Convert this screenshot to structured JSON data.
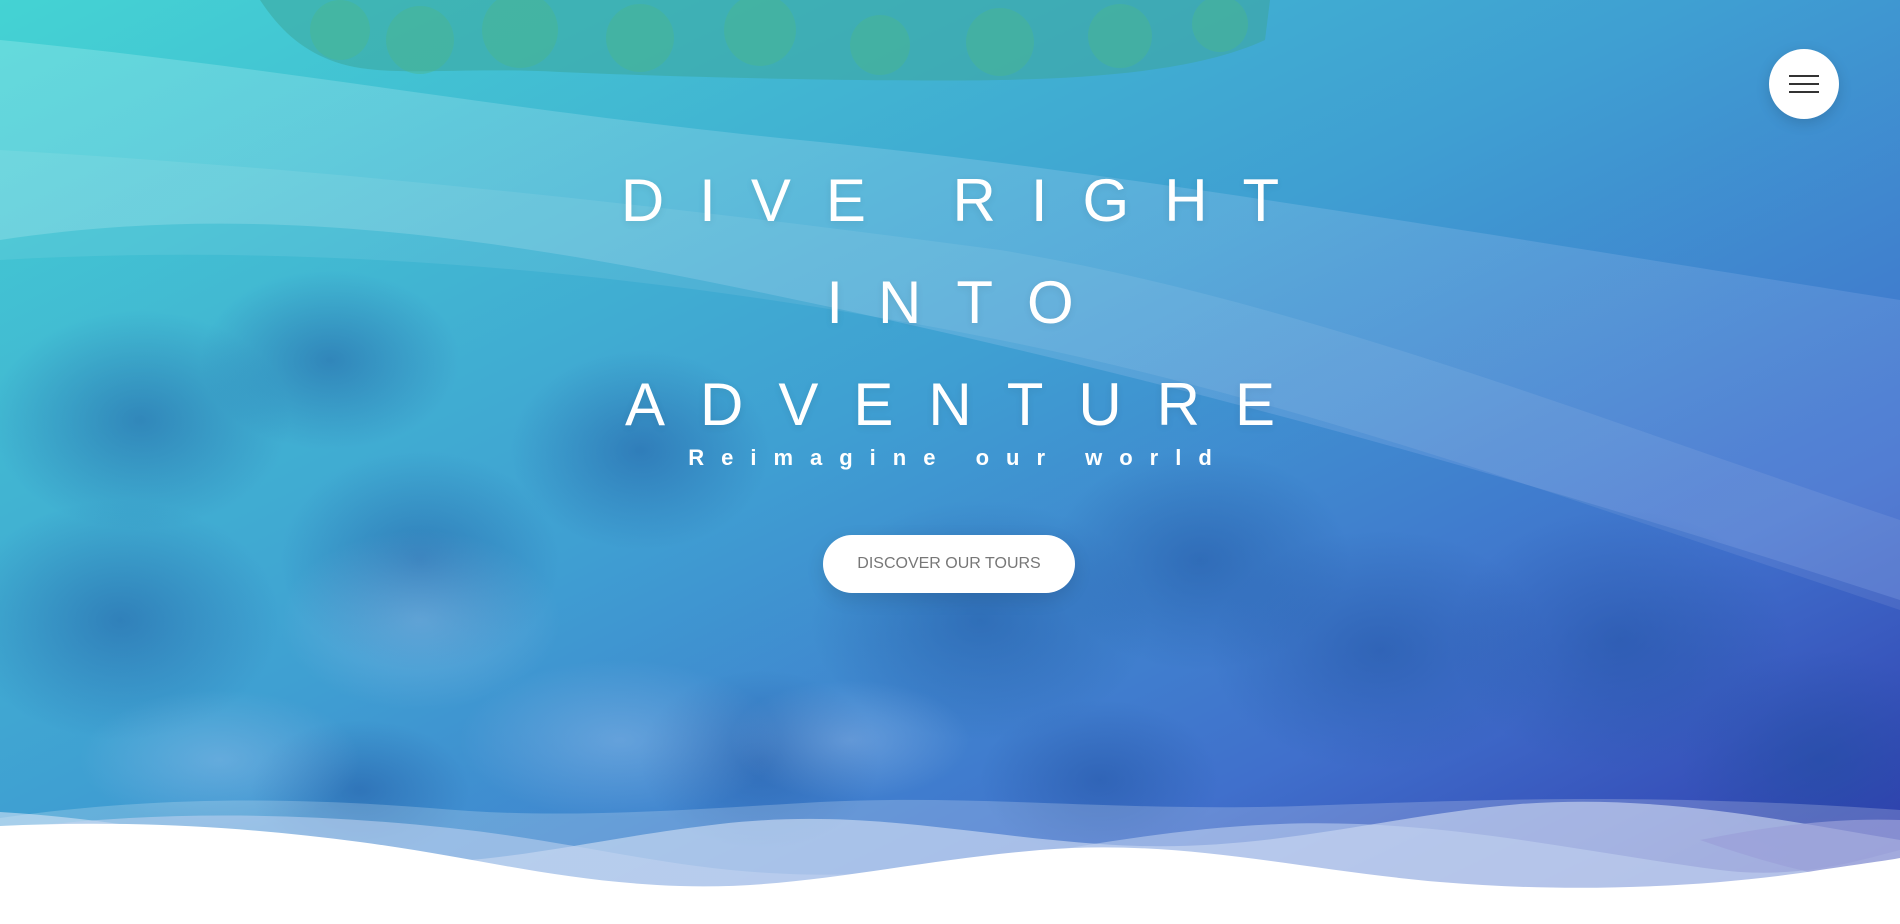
{
  "hero": {
    "heading_lines": [
      "DIVE RIGHT",
      "INTO",
      "ADVENTURE"
    ],
    "subheading": "Reimagine our world",
    "cta_label": "DISCOVER OUR TOURS"
  },
  "navigation": {
    "menu_icon": "hamburger-menu-icon"
  },
  "colors": {
    "gradient_start": "#3fd2d6",
    "gradient_end": "#3538ad",
    "button_text": "#777777",
    "text": "#ffffff"
  }
}
